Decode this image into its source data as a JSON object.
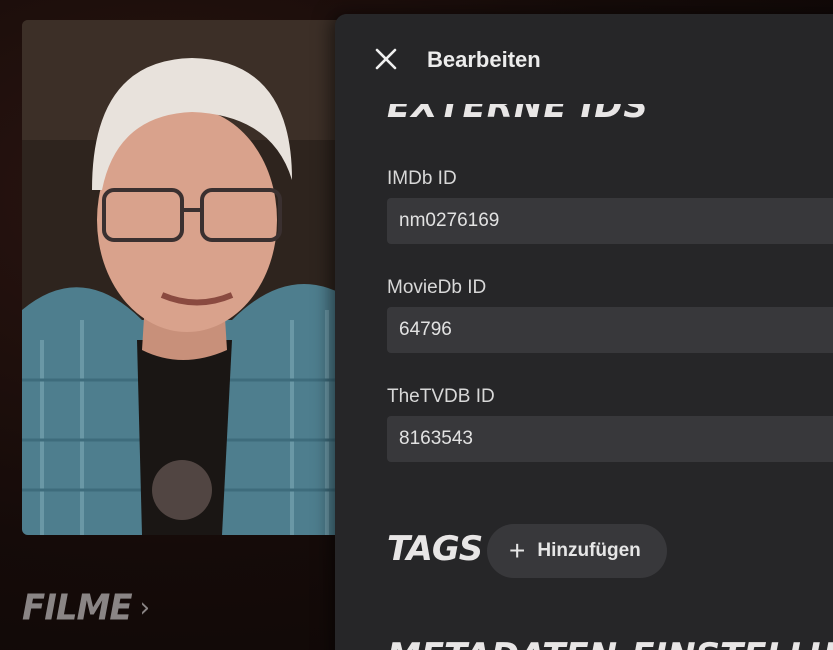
{
  "background": {
    "section_link": "Filme"
  },
  "dialog": {
    "title": "Bearbeiten",
    "external_ids_heading": "Externe IDs",
    "fields": [
      {
        "label": "IMDb ID",
        "value": "nm0276169"
      },
      {
        "label": "MovieDb ID",
        "value": "64796"
      },
      {
        "label": "TheTVDB ID",
        "value": "8163543"
      }
    ],
    "tags_heading": "Tags",
    "add_button_label": "Hinzufügen",
    "bottom_heading": "Metadaten-Einstellungen"
  },
  "colors": {
    "panel_bg": "#262628",
    "input_bg": "#38383b",
    "text": "#e2e2e2"
  },
  "icons": {
    "close": "close-icon",
    "plus": "plus-icon",
    "chevron": "chevron-right-icon"
  }
}
